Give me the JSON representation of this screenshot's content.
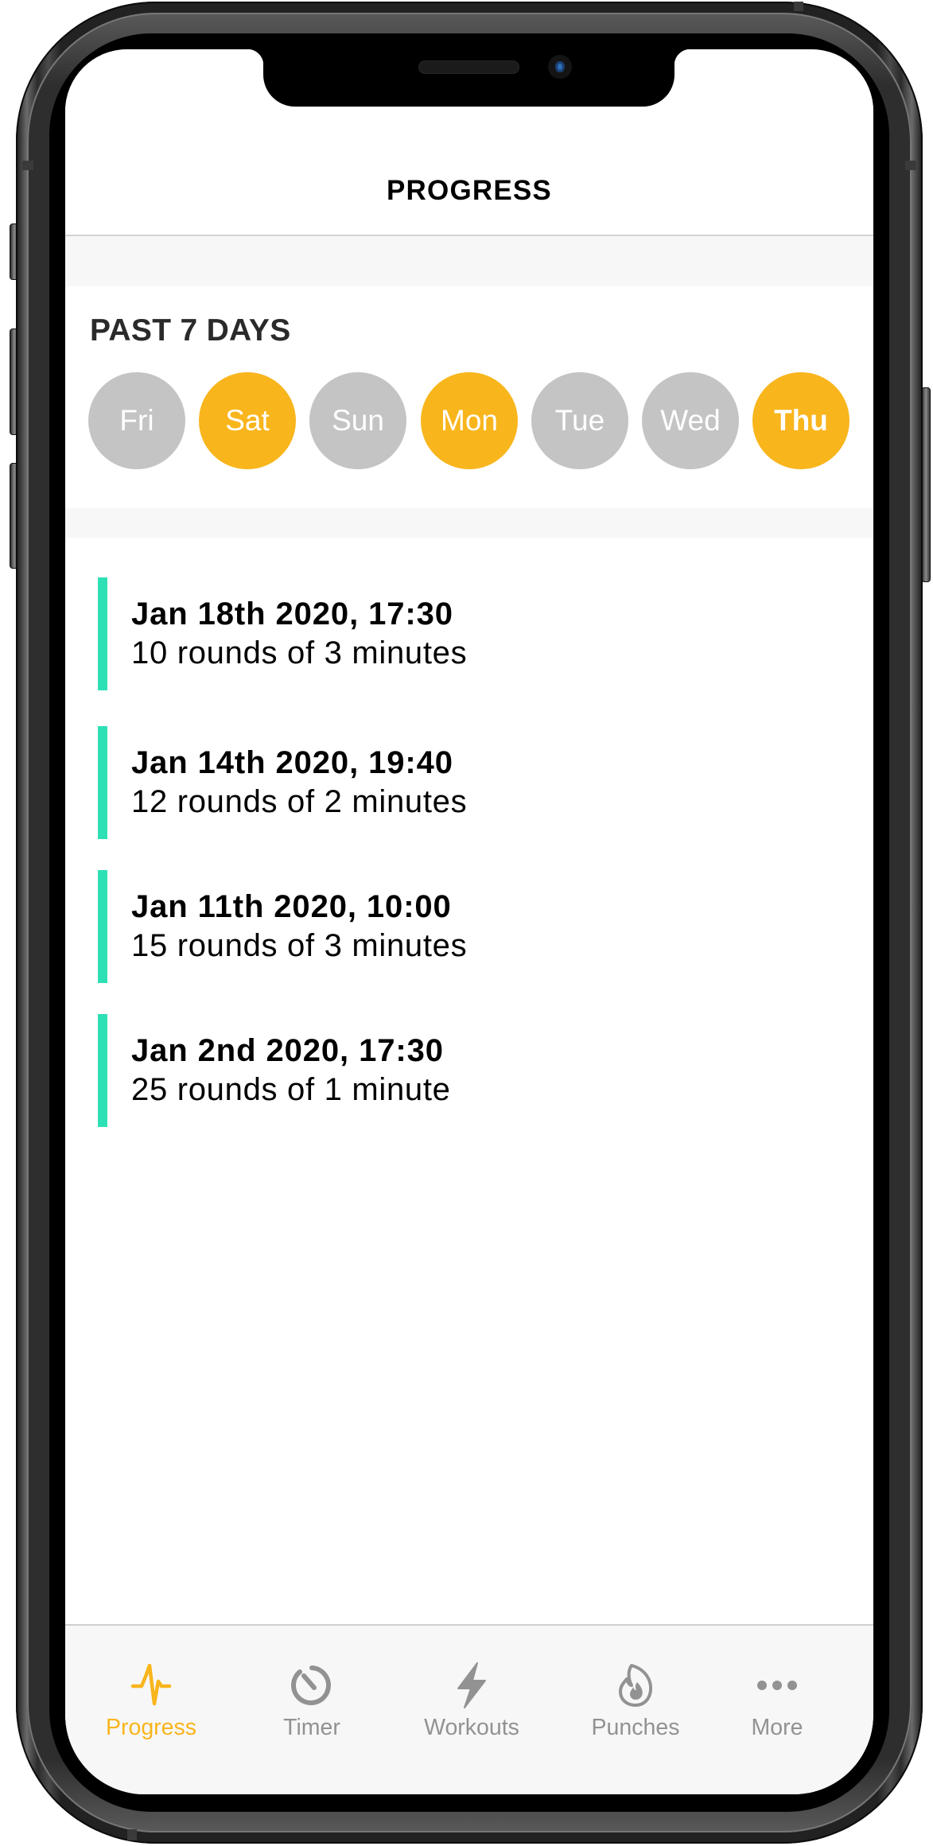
{
  "header": {
    "title": "PROGRESS"
  },
  "week": {
    "title": "PAST 7 DAYS",
    "days": [
      {
        "label": "Fri",
        "trained": false
      },
      {
        "label": "Sat",
        "trained": true
      },
      {
        "label": "Sun",
        "trained": false
      },
      {
        "label": "Mon",
        "trained": true
      },
      {
        "label": "Tue",
        "trained": false
      },
      {
        "label": "Wed",
        "trained": false
      },
      {
        "label": "Thu",
        "trained": true,
        "today": true
      }
    ]
  },
  "sessions": [
    {
      "date": "Jan 18th 2020, 17:30",
      "summary": "10 rounds of 3 minutes"
    },
    {
      "date": "Jan 14th 2020, 19:40",
      "summary": "12 rounds of 2 minutes"
    },
    {
      "date": "Jan 11th 2020, 10:00",
      "summary": "15 rounds of 3 minutes"
    },
    {
      "date": "Jan 2nd 2020, 17:30",
      "summary": "25 rounds of 1 minute"
    }
  ],
  "tabbar": {
    "tabs": [
      {
        "label": "Progress",
        "icon": "pulse-icon",
        "active": true
      },
      {
        "label": "Timer",
        "icon": "timer-icon",
        "active": false
      },
      {
        "label": "Workouts",
        "icon": "lightning-bolt-icon",
        "active": false
      },
      {
        "label": "Punches",
        "icon": "flame-icon",
        "active": false
      },
      {
        "label": "More",
        "icon": "more-dots-icon",
        "active": false
      }
    ]
  },
  "colors": {
    "accent": "#F8B51C",
    "inactive_day": "#C4C4C4",
    "session_bar": "#2EE0B5",
    "tab_inactive": "#929292"
  }
}
